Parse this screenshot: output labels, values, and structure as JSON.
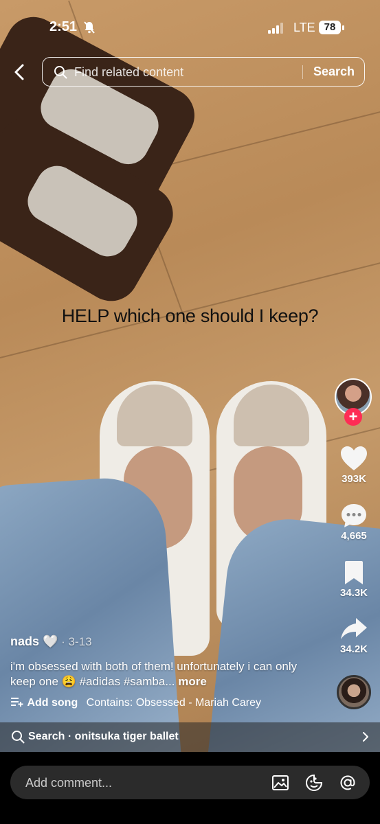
{
  "status_bar": {
    "time": "2:51",
    "network": "LTE",
    "battery": "78"
  },
  "search": {
    "placeholder": "Find related content",
    "button_label": "Search"
  },
  "video": {
    "overlay_text": "HELP which one should I keep?"
  },
  "actions": {
    "likes": "393K",
    "comments": "4,665",
    "saves": "34.3K",
    "shares": "34.2K",
    "follow_symbol": "+"
  },
  "post": {
    "username": "nads 🤍",
    "date": " · 3-13",
    "description": "i'm obsessed with both of them! unfortunately i can only keep one 😩 #adidas #samba...",
    "more_label": " more",
    "add_song_label": "Add song",
    "contains_label": "Contains: Obsessed - Mariah Carey"
  },
  "search_suggestion": {
    "text": "Search · onitsuka tiger ballet"
  },
  "comment": {
    "placeholder": "Add comment..."
  },
  "colors": {
    "accent": "#fe2c55",
    "bar_bg": "#2b2b2b"
  }
}
